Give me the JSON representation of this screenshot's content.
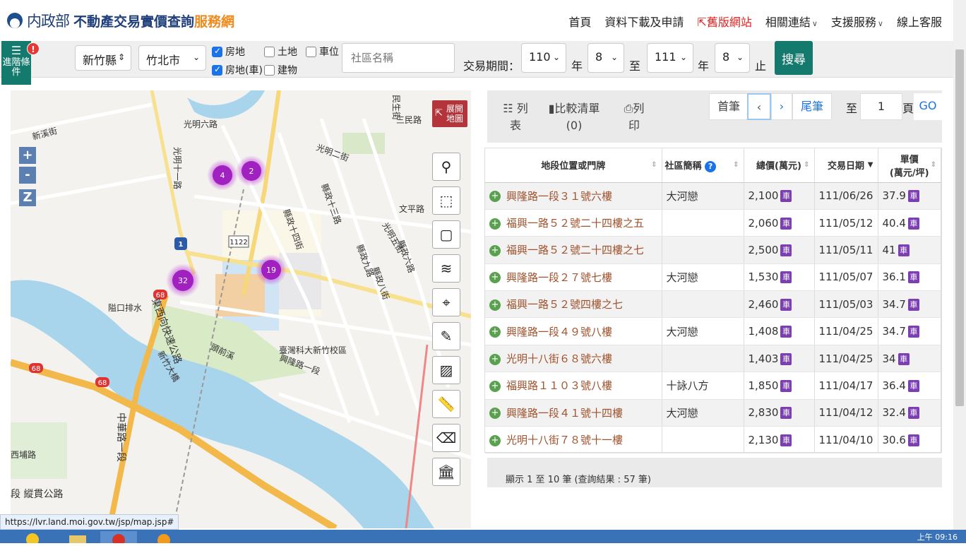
{
  "header": {
    "ministry": "内政部",
    "site_title": "不動產交易實價查詢",
    "site_title_accent": "服務網",
    "nav": {
      "home": "首頁",
      "download": "資料下載及申請",
      "old_site": "舊版網站",
      "links": "相關連結",
      "support": "支援服務",
      "customer_service": "線上客服"
    }
  },
  "filters": {
    "advanced_label": "進階條件",
    "advanced_badge": "!",
    "county": "新竹縣",
    "district": "竹北市",
    "checkbox_house": "房地",
    "checkbox_house_car": "房地(車)",
    "checkbox_land": "土地",
    "checkbox_building": "建物",
    "checkbox_parking": "車位",
    "community_placeholder": "社區名稱",
    "period_label": "交易期間：",
    "start_year": "110",
    "start_month": "8",
    "end_year": "111",
    "end_month": "8",
    "year_unit": "年",
    "to_label": "至",
    "end_label": "止",
    "search_label": "搜尋"
  },
  "map": {
    "expand_label_1": "展開",
    "expand_label_2": "地圖",
    "zoom_in": "+",
    "zoom_out": "-",
    "zoom_reset": "Z",
    "clusters": [
      "4",
      "2",
      "19",
      "32"
    ],
    "road_labels": {
      "guangming6": "光明六路",
      "guangming11": "光明十一路",
      "guangming2": "光明二街",
      "wenping": "文平路",
      "guangming5": "光明五街",
      "xiaozheng13": "縣政十三路",
      "xiaozheng14": "縣政十四街",
      "xiaozheng9": "縣政九路",
      "xiaozheng8": "縣政八街",
      "xiaozheng6": "縣政六路",
      "xingtai": "興隆路一段",
      "toqian": "頭前溪",
      "xinzhu": "新竹大橋",
      "dongxi": "東西向快速公路",
      "zhonghua": "中華路一段",
      "duanzong": "段 縱貫公路",
      "xibu": "西埔路",
      "xinxi": "新溪街",
      "gaoshan": "隘口排水",
      "campus": "臺灣科大新竹校區",
      "sanmin": "三民路",
      "minsheng": "民生街",
      "shield_1": "1",
      "shield_122": "1122",
      "shield_68a": "68",
      "shield_68b": "68",
      "shield_68c": "68"
    }
  },
  "toolbar": {
    "list_label_1": "列",
    "list_label_2": "表",
    "compare_label": "比較清單",
    "compare_count": "(0)",
    "print_label_1": "列",
    "print_label_2": "印",
    "first_page": "首筆",
    "prev_page": "‹",
    "next_page": "›",
    "last_page": "尾筆",
    "to_label": "至",
    "page_value": "1",
    "page_unit": "頁",
    "go_label": "GO"
  },
  "table": {
    "headers": [
      "地段位置或門牌",
      "社區簡稱",
      "總價(萬元)",
      "交易日期",
      "單價"
    ],
    "unit_price_sub": "(萬元/坪)",
    "car_badge": "車",
    "rows": [
      {
        "address": "興隆路一段３１號六樓",
        "community": "大河戀",
        "total": "2,100",
        "date": "111/06/26",
        "unit": "37.9"
      },
      {
        "address": "福興一路５２號二十四樓之五",
        "community": "",
        "total": "2,060",
        "date": "111/05/12",
        "unit": "40.4"
      },
      {
        "address": "福興一路５２號二十四樓之七",
        "community": "",
        "total": "2,500",
        "date": "111/05/11",
        "unit": "41"
      },
      {
        "address": "興隆路一段２７號七樓",
        "community": "大河戀",
        "total": "1,530",
        "date": "111/05/07",
        "unit": "36.1"
      },
      {
        "address": "福興一路５２號四樓之七",
        "community": "",
        "total": "2,460",
        "date": "111/05/03",
        "unit": "34.7"
      },
      {
        "address": "興隆路一段４９號八樓",
        "community": "大河戀",
        "total": "1,408",
        "date": "111/04/25",
        "unit": "34.7"
      },
      {
        "address": "光明十八街６８號六樓",
        "community": "",
        "total": "1,403",
        "date": "111/04/25",
        "unit": "34"
      },
      {
        "address": "福興路１１０３號八樓",
        "community": "十詠八方",
        "total": "1,850",
        "date": "111/04/17",
        "unit": "36.4"
      },
      {
        "address": "興隆路一段４１號十四樓",
        "community": "大河戀",
        "total": "2,830",
        "date": "111/04/12",
        "unit": "32.4"
      },
      {
        "address": "光明十八街７８號十一樓",
        "community": "",
        "total": "2,130",
        "date": "111/04/10",
        "unit": "30.6"
      }
    ]
  },
  "footer": {
    "summary": "顯示 1 至 10 筆 (查詢結果 : 57 筆)"
  },
  "status": {
    "url": "https://lvr.land.moi.gov.tw/jsp/map.jsp#",
    "clock": "上午 09:16"
  }
}
